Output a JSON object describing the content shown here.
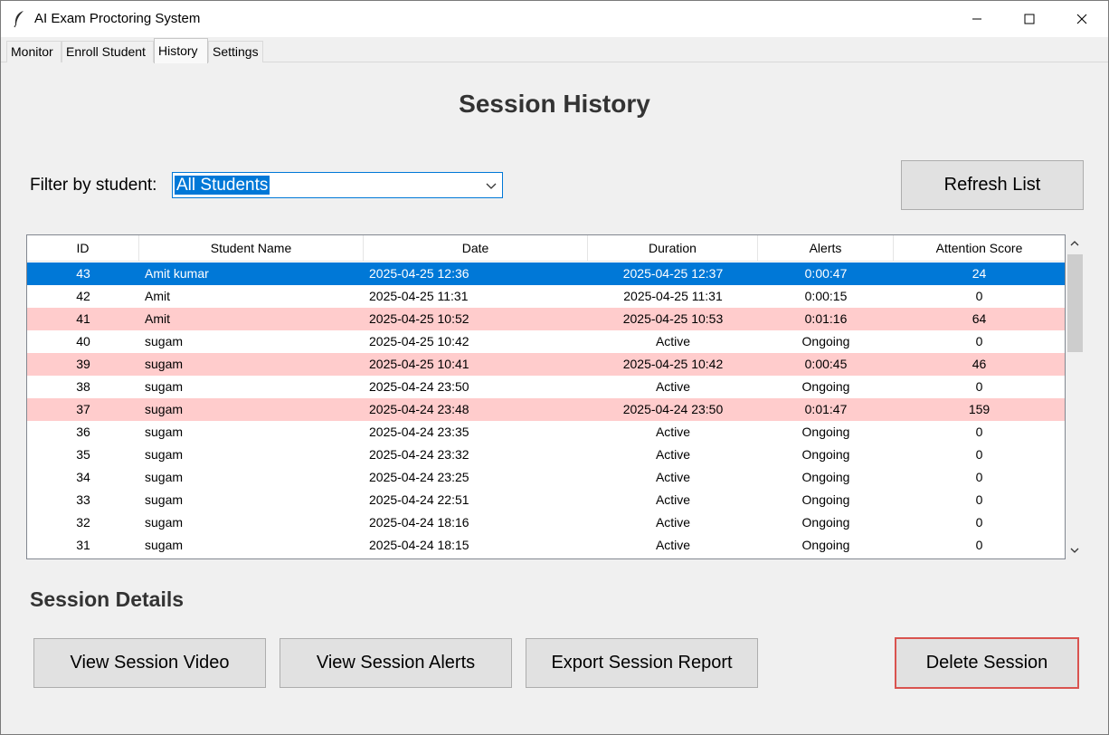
{
  "window": {
    "title": "AI Exam Proctoring System"
  },
  "tabs": [
    {
      "label": "Monitor",
      "active": false
    },
    {
      "label": "Enroll Student",
      "active": false
    },
    {
      "label": "History",
      "active": true
    },
    {
      "label": "Settings",
      "active": false
    }
  ],
  "page": {
    "title": "Session History"
  },
  "filter": {
    "label": "Filter by student:",
    "selected": "All Students"
  },
  "refresh_label": "Refresh List",
  "table": {
    "columns": [
      "ID",
      "Student Name",
      "Date",
      "Duration",
      "Alerts",
      "Attention Score"
    ],
    "rows": [
      {
        "id": "43",
        "name": "Amit kumar",
        "date": "2025-04-25 12:36",
        "duration": "2025-04-25 12:37",
        "alerts": "0:00:47",
        "score": "24",
        "state": "selected"
      },
      {
        "id": "42",
        "name": "Amit",
        "date": "2025-04-25 11:31",
        "duration": "2025-04-25 11:31",
        "alerts": "0:00:15",
        "score": "0",
        "state": "normal"
      },
      {
        "id": "41",
        "name": "Amit",
        "date": "2025-04-25 10:52",
        "duration": "2025-04-25 10:53",
        "alerts": "0:01:16",
        "score": "64",
        "state": "flagged"
      },
      {
        "id": "40",
        "name": "sugam",
        "date": "2025-04-25 10:42",
        "duration": "Active",
        "alerts": "Ongoing",
        "score": "0",
        "state": "normal"
      },
      {
        "id": "39",
        "name": "sugam",
        "date": "2025-04-25 10:41",
        "duration": "2025-04-25 10:42",
        "alerts": "0:00:45",
        "score": "46",
        "state": "flagged"
      },
      {
        "id": "38",
        "name": "sugam",
        "date": "2025-04-24 23:50",
        "duration": "Active",
        "alerts": "Ongoing",
        "score": "0",
        "state": "normal"
      },
      {
        "id": "37",
        "name": "sugam",
        "date": "2025-04-24 23:48",
        "duration": "2025-04-24 23:50",
        "alerts": "0:01:47",
        "score": "159",
        "state": "flagged"
      },
      {
        "id": "36",
        "name": "sugam",
        "date": "2025-04-24 23:35",
        "duration": "Active",
        "alerts": "Ongoing",
        "score": "0",
        "state": "normal"
      },
      {
        "id": "35",
        "name": "sugam",
        "date": "2025-04-24 23:32",
        "duration": "Active",
        "alerts": "Ongoing",
        "score": "0",
        "state": "normal"
      },
      {
        "id": "34",
        "name": "sugam",
        "date": "2025-04-24 23:25",
        "duration": "Active",
        "alerts": "Ongoing",
        "score": "0",
        "state": "normal"
      },
      {
        "id": "33",
        "name": "sugam",
        "date": "2025-04-24 22:51",
        "duration": "Active",
        "alerts": "Ongoing",
        "score": "0",
        "state": "normal"
      },
      {
        "id": "32",
        "name": "sugam",
        "date": "2025-04-24 18:16",
        "duration": "Active",
        "alerts": "Ongoing",
        "score": "0",
        "state": "normal"
      },
      {
        "id": "31",
        "name": "sugam",
        "date": "2025-04-24 18:15",
        "duration": "Active",
        "alerts": "Ongoing",
        "score": "0",
        "state": "normal"
      }
    ]
  },
  "details": {
    "title": "Session Details",
    "view_video_label": "View Session Video",
    "view_alerts_label": "View Session Alerts",
    "export_label": "Export Session Report",
    "delete_label": "Delete Session"
  },
  "colors": {
    "selected_row_bg": "#0078d7",
    "flagged_row_bg": "#ffcccc",
    "delete_border": "#d9534f"
  }
}
